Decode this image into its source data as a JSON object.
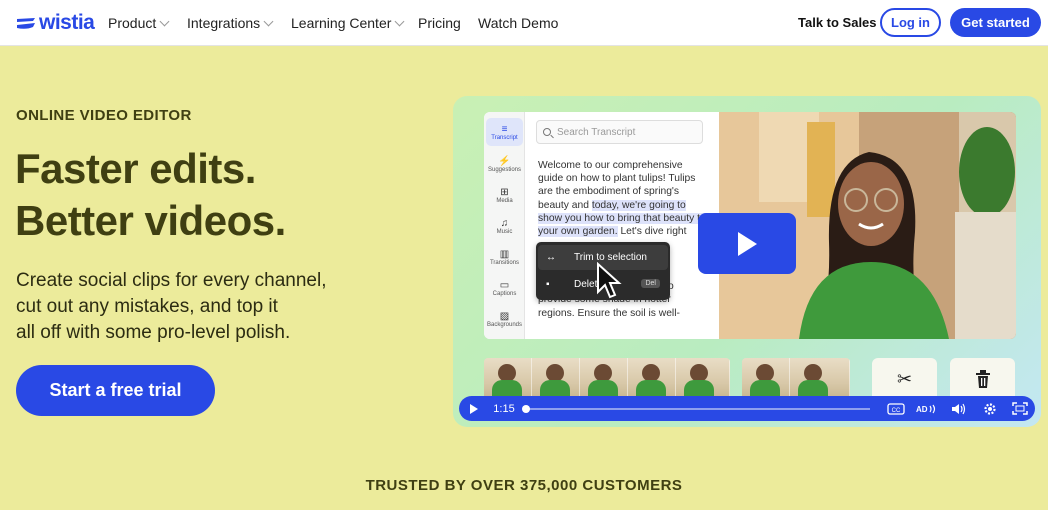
{
  "nav": {
    "brand": "wistia",
    "items": [
      {
        "label": "Product",
        "has_dropdown": true
      },
      {
        "label": "Integrations",
        "has_dropdown": true
      },
      {
        "label": "Learning Center",
        "has_dropdown": true
      },
      {
        "label": "Pricing",
        "has_dropdown": false
      },
      {
        "label": "Watch Demo",
        "has_dropdown": false
      }
    ],
    "talk_to_sales": "Talk to Sales",
    "login": "Log in",
    "get_started": "Get started"
  },
  "hero": {
    "eyebrow": "ONLINE VIDEO EDITOR",
    "headline_1": "Faster edits.",
    "headline_2": "Better videos.",
    "sub_1": "Create social clips for every channel,",
    "sub_2": "cut out any mistakes, and top it",
    "sub_3": "all off with some pro-level polish.",
    "cta": "Start a free trial"
  },
  "editor": {
    "rail": [
      {
        "label": "Transcript",
        "icon": "transcript-icon",
        "glyph": "≡"
      },
      {
        "label": "Suggestions",
        "icon": "lightning-icon",
        "glyph": "⚡"
      },
      {
        "label": "Media",
        "icon": "media-icon",
        "glyph": "⊞"
      },
      {
        "label": "Music",
        "icon": "music-icon",
        "glyph": "♫"
      },
      {
        "label": "Transitions",
        "icon": "transitions-icon",
        "glyph": "▥"
      },
      {
        "label": "Captions",
        "icon": "captions-icon",
        "glyph": "▭"
      },
      {
        "label": "Backgrounds",
        "icon": "backgrounds-icon",
        "glyph": "▨"
      }
    ],
    "search_placeholder": "Search Transcript",
    "transcript_before": "Welcome to our comprehensive guide on how to plant tulips! Tulips are the embodiment of spring's beauty and ",
    "transcript_highlight": "today, we're going to show you how to bring that beauty to your own garden.",
    "transcript_after": " Let's dive right",
    "transcript_tail_1": "plenty of sunlight but can also",
    "transcript_tail_2": "provide some shade in hotter",
    "transcript_tail_3": "regions. Ensure the soil is well-",
    "menu": {
      "trim": "Trim to selection",
      "delete": "Delete",
      "delete_key": "Del"
    }
  },
  "player": {
    "time": "1:15",
    "progress_fraction": 0.0
  },
  "tools": [
    {
      "icon": "scissors-icon",
      "glyph": "✂"
    },
    {
      "icon": "trash-icon",
      "glyph": "🗑"
    }
  ],
  "trusted": "TRUSTED BY OVER 375,000 CUSTOMERS",
  "colors": {
    "brand_blue": "#2949e5",
    "page_bg": "#eceb9b",
    "headline": "#3f3f12"
  }
}
